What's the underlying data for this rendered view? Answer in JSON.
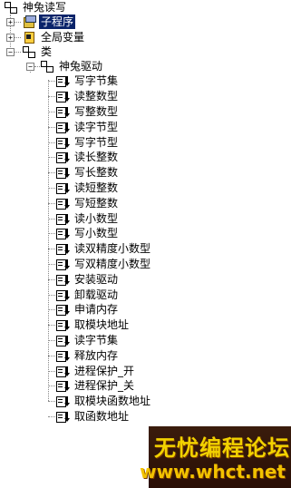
{
  "tree": {
    "root": "神兔读写",
    "sub_program": "子程序",
    "globals": "全局变量",
    "classes": "类",
    "class_name": "神兔驱动",
    "methods": [
      "写字节集",
      "读整数型",
      "写整数型",
      "读字节型",
      "写字节型",
      "读长整数",
      "写长整数",
      "读短整数",
      "写短整数",
      "读小数型",
      "写小数型",
      "读双精度小数型",
      "写双精度小数型",
      "安装驱动",
      "卸载驱动",
      "申请内存",
      "取模块地址",
      "读字节集",
      "释放内存",
      "进程保护_开",
      "进程保护_关",
      "取模块函数地址",
      "取函数地址"
    ]
  },
  "expand_glyphs": {
    "collapsed": "+",
    "expanded": "−"
  },
  "watermark": {
    "title": "无忧编程论坛",
    "url": "www.whct.net"
  },
  "colors": {
    "selection": "#0a246a",
    "watermark_bg": "#2a0f06",
    "watermark_text": "#f2d200"
  }
}
